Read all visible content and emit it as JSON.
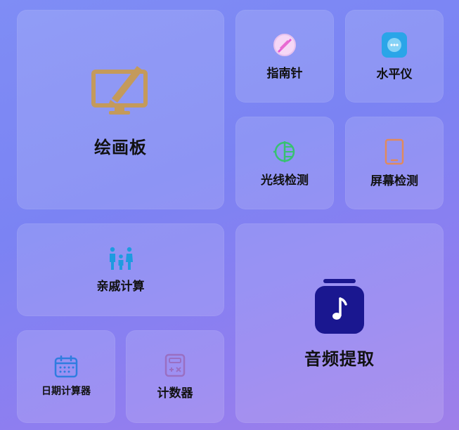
{
  "tools": {
    "drawing_board": {
      "label": "绘画板",
      "icon": "drawing-board-icon",
      "color": "#c49a5b"
    },
    "compass": {
      "label": "指南针",
      "icon": "compass-icon",
      "color": "#e45bd6"
    },
    "level": {
      "label": "水平仪",
      "icon": "level-icon",
      "color": "#2aa5e8"
    },
    "light_meter": {
      "label": "光线检测",
      "icon": "light-meter-icon",
      "color": "#38c172"
    },
    "screen_test": {
      "label": "屏幕检测",
      "icon": "screen-test-icon",
      "color": "#e08a5e"
    },
    "relative_calc": {
      "label": "亲戚计算",
      "icon": "family-icon",
      "color": "#1e9be0"
    },
    "audio_extract": {
      "label": "音频提取",
      "icon": "music-note-icon",
      "color": "#1a1790"
    },
    "date_calc": {
      "label": "日期计算器",
      "icon": "calendar-icon",
      "color": "#2f7de0"
    },
    "counter": {
      "label": "计数器",
      "icon": "calculator-icon",
      "color": "#9a6fc2"
    }
  }
}
